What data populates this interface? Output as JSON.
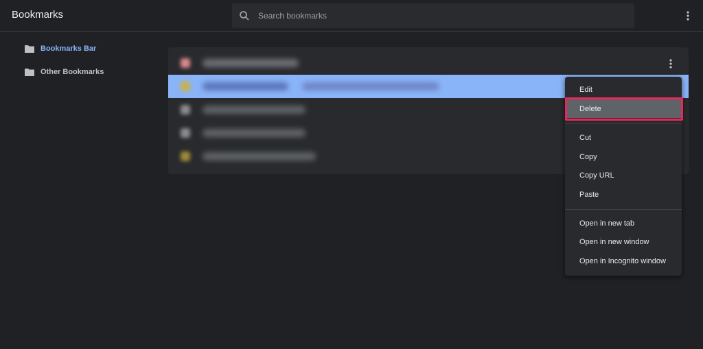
{
  "header": {
    "title": "Bookmarks",
    "search_placeholder": "Search bookmarks"
  },
  "sidebar": {
    "items": [
      {
        "label": "Bookmarks Bar",
        "icon": "folder-icon",
        "active": true
      },
      {
        "label": "Other Bookmarks",
        "icon": "folder-icon",
        "active": false
      }
    ]
  },
  "context_menu": {
    "items": [
      {
        "label": "Edit"
      },
      {
        "label": "Delete"
      },
      {
        "label": "Cut"
      },
      {
        "label": "Copy"
      },
      {
        "label": "Copy URL"
      },
      {
        "label": "Paste"
      },
      {
        "label": "Open in new tab"
      },
      {
        "label": "Open in new window"
      },
      {
        "label": "Open in Incognito window"
      }
    ],
    "highlighted_item": "Delete"
  },
  "colors": {
    "accent": "#8ab4f8",
    "highlight_outline": "#e8265c",
    "background": "#202124",
    "card": "#292a2d"
  }
}
